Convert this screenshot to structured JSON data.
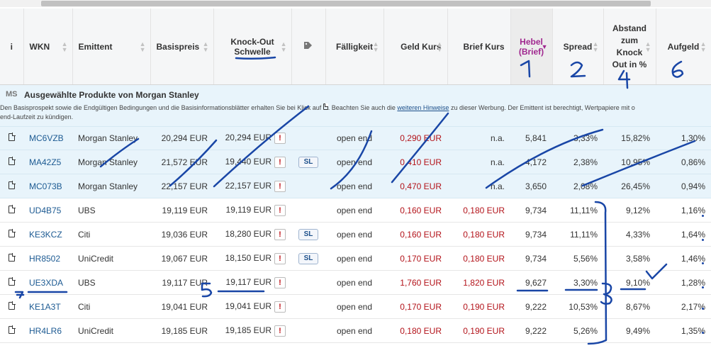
{
  "headers": {
    "info": "i",
    "wkn": "WKN",
    "emittent": "Emittent",
    "basispreis": "Basispreis",
    "knockout_line1": "Knock-Out",
    "knockout_line2": "Schwelle",
    "faelligkeit": "Fälligkeit",
    "geld": "Geld Kurs",
    "brief": "Brief Kurs",
    "hebel_line1": "Hebel",
    "hebel_line2": "(Brief)",
    "spread": "Spread",
    "abstand": "Abstand zum Knock Out in %",
    "aufgeld": "Aufgeld"
  },
  "section": {
    "icon_label": "MS",
    "title": "Ausgewählte Produkte von Morgan Stanley",
    "note_part1": "Den Basisprospekt sowie die Endgültigen Bedingungen und die Basisinformationsblätter erhalten Sie bei Klick auf",
    "note_part2": ". Beachten Sie auch die",
    "note_link": "weiteren Hinweise",
    "note_part3": "zu dieser Werbung. Der Emittent ist berechtigt, Wertpapiere mit o",
    "note_line2": "end-Laufzeit zu kündigen."
  },
  "warn_label": "!",
  "sl_label": "SL",
  "rows": [
    {
      "wkn": "MC6VZB",
      "emittent": "Morgan Stanley",
      "basispreis": "20,294 EUR",
      "ko": "20,294 EUR",
      "sl": false,
      "faelligkeit": "open end",
      "geld": "0,290 EUR",
      "brief": "n.a.",
      "hebel": "5,841",
      "spread": "3,33%",
      "abstand": "15,82%",
      "aufgeld": "1,30%",
      "highlight": true
    },
    {
      "wkn": "MA42Z5",
      "emittent": "Morgan Stanley",
      "basispreis": "21,572 EUR",
      "ko": "19,440 EUR",
      "sl": true,
      "faelligkeit": "open end",
      "geld": "0,410 EUR",
      "brief": "n.a.",
      "hebel": "4,172",
      "spread": "2,38%",
      "abstand": "10,95%",
      "aufgeld": "0,86%",
      "highlight": true
    },
    {
      "wkn": "MC073B",
      "emittent": "Morgan Stanley",
      "basispreis": "22,157 EUR",
      "ko": "22,157 EUR",
      "sl": false,
      "faelligkeit": "open end",
      "geld": "0,470 EUR",
      "brief": "n.a.",
      "hebel": "3,650",
      "spread": "2,08%",
      "abstand": "26,45%",
      "aufgeld": "0,94%",
      "highlight": true
    },
    {
      "wkn": "UD4B75",
      "emittent": "UBS",
      "basispreis": "19,119 EUR",
      "ko": "19,119 EUR",
      "sl": false,
      "faelligkeit": "open end",
      "geld": "0,160 EUR",
      "brief": "0,180 EUR",
      "hebel": "9,734",
      "spread": "11,11%",
      "abstand": "9,12%",
      "aufgeld": "1,16%",
      "highlight": false
    },
    {
      "wkn": "KE3KCZ",
      "emittent": "Citi",
      "basispreis": "19,036 EUR",
      "ko": "18,280 EUR",
      "sl": true,
      "faelligkeit": "open end",
      "geld": "0,160 EUR",
      "brief": "0,180 EUR",
      "hebel": "9,734",
      "spread": "11,11%",
      "abstand": "4,33%",
      "aufgeld": "1,64%",
      "highlight": false
    },
    {
      "wkn": "HR8502",
      "emittent": "UniCredit",
      "basispreis": "19,067 EUR",
      "ko": "18,150 EUR",
      "sl": true,
      "faelligkeit": "open end",
      "geld": "0,170 EUR",
      "brief": "0,180 EUR",
      "hebel": "9,734",
      "spread": "5,56%",
      "abstand": "3,58%",
      "aufgeld": "1,46%",
      "highlight": false
    },
    {
      "wkn": "UE3XDA",
      "emittent": "UBS",
      "basispreis": "19,117 EUR",
      "ko": "19,117 EUR",
      "sl": false,
      "faelligkeit": "open end",
      "geld": "1,760 EUR",
      "brief": "1,820 EUR",
      "hebel": "9,627",
      "spread": "3,30%",
      "abstand": "9,10%",
      "aufgeld": "1,28%",
      "highlight": false
    },
    {
      "wkn": "KE1A3T",
      "emittent": "Citi",
      "basispreis": "19,041 EUR",
      "ko": "19,041 EUR",
      "sl": false,
      "faelligkeit": "open end",
      "geld": "0,170 EUR",
      "brief": "0,190 EUR",
      "hebel": "9,222",
      "spread": "10,53%",
      "abstand": "8,67%",
      "aufgeld": "2,17%",
      "highlight": false
    },
    {
      "wkn": "HR4LR6",
      "emittent": "UniCredit",
      "basispreis": "19,185 EUR",
      "ko": "19,185 EUR",
      "sl": false,
      "faelligkeit": "open end",
      "geld": "0,180 EUR",
      "brief": "0,190 EUR",
      "hebel": "9,222",
      "spread": "5,26%",
      "abstand": "9,49%",
      "aufgeld": "1,35%",
      "highlight": false
    }
  ],
  "annotations": {
    "n1": "1",
    "n2": "2",
    "n3": "3",
    "n4": "4",
    "n5": "5",
    "n6": "6",
    "n7": "7"
  },
  "colors": {
    "accent_sort": "#a0278f",
    "price_red": "#b3131a",
    "wkn_blue": "#1c5a92",
    "highlight_bg": "#e8f4fb",
    "ink": "#1946a6"
  }
}
